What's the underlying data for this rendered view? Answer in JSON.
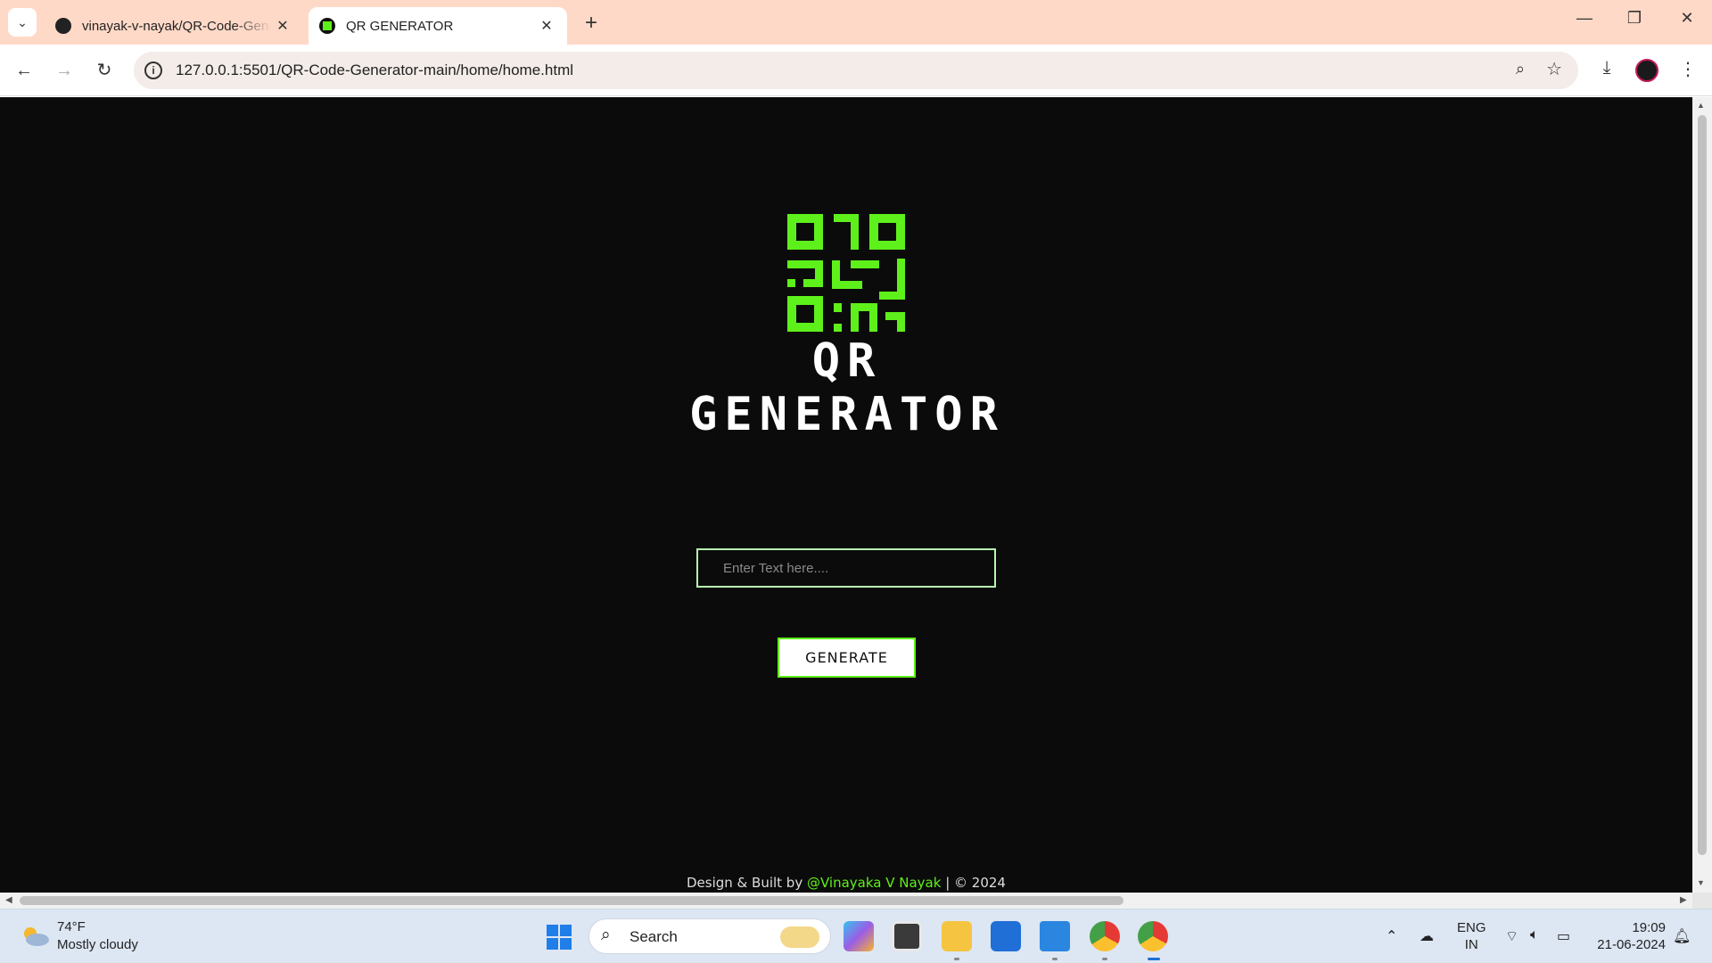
{
  "browser": {
    "tabs": [
      {
        "title": "vinayak-v-nayak/QR-Code-Generator-main",
        "active": false
      },
      {
        "title": "QR GENERATOR",
        "active": true
      }
    ],
    "url": "127.0.0.1:5501/QR-Code-Generator-main/home/home.html"
  },
  "page": {
    "logo_text": "QR GENERATOR",
    "input_placeholder": "Enter Text here....",
    "generate_label": "GENERATE",
    "footer_prefix": "Design & Built by ",
    "footer_author": "@Vinayaka V Nayak",
    "footer_suffix": " | © 2024",
    "accent_color": "#5ef01a",
    "background_color": "#0b0b0b"
  },
  "taskbar": {
    "weather_temp": "74°F",
    "weather_desc": "Mostly cloudy",
    "search_label": "Search",
    "lang_line1": "ENG",
    "lang_line2": "IN",
    "time": "19:09",
    "date": "21-06-2024"
  }
}
